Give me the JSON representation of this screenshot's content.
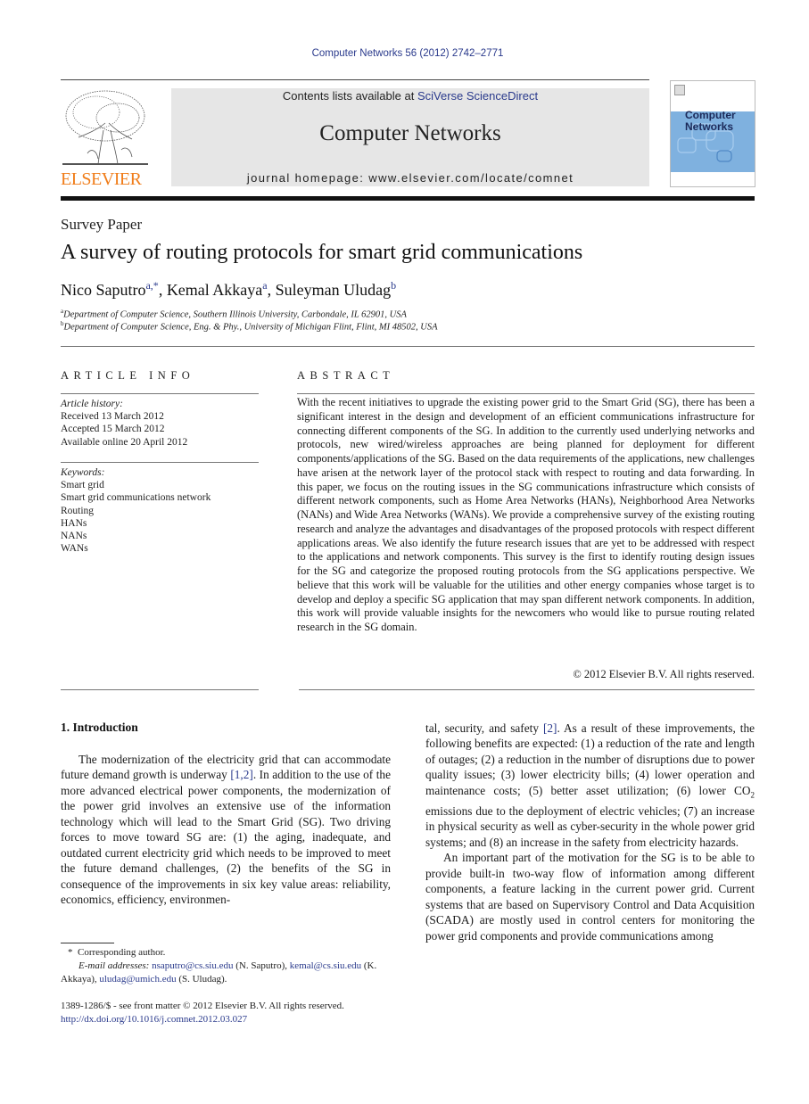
{
  "header": {
    "journal_reference": "Computer Networks 56 (2012) 2742–2771",
    "contents_prefix": "Contents lists available at ",
    "contents_link": "SciVerse ScienceDirect",
    "journal_name": "Computer Networks",
    "homepage": "journal homepage: www.elsevier.com/locate/comnet",
    "publisher_logo_text": "ELSEVIER",
    "cover_title_line1": "Computer",
    "cover_title_line2": "Networks",
    "colors": {
      "publisher_orange": "#f07d1a",
      "link_blue": "#2a3a8c",
      "cover_blue": "#7fb1df",
      "banner_gray": "#e6e6e6"
    }
  },
  "article": {
    "type_label": "Survey Paper",
    "title": "A survey of routing protocols for smart grid communications",
    "authors": [
      {
        "name": "Nico Saputro",
        "marks": "a,*"
      },
      {
        "name": "Kemal Akkaya",
        "marks": "a"
      },
      {
        "name": "Suleyman Uludag",
        "marks": "b"
      }
    ],
    "affiliations": [
      {
        "mark": "a",
        "text": "Department of Computer Science, Southern Illinois University, Carbondale, IL 62901, USA"
      },
      {
        "mark": "b",
        "text": "Department of Computer Science, Eng. & Phy., University of Michigan Flint, Flint, MI 48502, USA"
      }
    ]
  },
  "article_info": {
    "heading": "ARTICLE INFO",
    "history_label": "Article history:",
    "history": [
      "Received 13 March 2012",
      "Accepted 15 March 2012",
      "Available online 20 April 2012"
    ],
    "keywords_label": "Keywords:",
    "keywords": [
      "Smart grid",
      "Smart grid communications network",
      "Routing",
      "HANs",
      "NANs",
      "WANs"
    ]
  },
  "abstract": {
    "heading": "ABSTRACT",
    "text": "With the recent initiatives to upgrade the existing power grid to the Smart Grid (SG), there has been a significant interest in the design and development of an efficient communications infrastructure for connecting different components of the SG. In addition to the currently used underlying networks and protocols, new wired/wireless approaches are being planned for deployment for different components/applications of the SG. Based on the data requirements of the applications, new challenges have arisen at the network layer of the protocol stack with respect to routing and data forwarding. In this paper, we focus on the routing issues in the SG communications infrastructure which consists of different network components, such as Home Area Networks (HANs), Neighborhood Area Networks (NANs) and Wide Area Networks (WANs). We provide a comprehensive survey of the existing routing research and analyze the advantages and disadvantages of the proposed protocols with respect different applications areas. We also identify the future research issues that are yet to be addressed with respect to the applications and network components. This survey is the first to identify routing design issues for the SG and categorize the proposed routing protocols from the SG applications perspective. We believe that this work will be valuable for the utilities and other energy companies whose target is to develop and deploy a specific SG application that may span different network components. In addition, this work will provide valuable insights for the newcomers who would like to pursue routing related research in the SG domain.",
    "copyright": "© 2012 Elsevier B.V. All rights reserved."
  },
  "body": {
    "section_heading": "1. Introduction",
    "left_p1_a": "The modernization of the electricity grid that can accommodate future demand growth is underway ",
    "left_p1_cite": "[1,2]",
    "left_p1_b": ". In addition to the use of the more advanced electrical power components, the modernization of the power grid involves an extensive use of the information technology which will lead to the Smart Grid (SG). Two driving forces to move toward SG are: (1) the aging, inadequate, and outdated current electricity grid which needs to be improved to meet the future demand challenges, (2) the benefits of the SG in consequence of the improvements in six key value areas: reliability, economics, efficiency, environmen-",
    "right_p1_a": "tal, security, and safety ",
    "right_p1_cite": "[2]",
    "right_p1_b": ". As a result of these improvements, the following benefits are expected: (1) a reduction of the rate and length of outages; (2) a reduction in the number of disruptions due to power quality issues; (3) lower electricity bills; (4) lower operation and maintenance costs; (5) better asset utilization; (6) lower CO",
    "right_p1_sub": "2",
    "right_p1_c": " emissions due to the deployment of electric vehicles; (7) an increase in physical security as well as cyber-security in the whole power grid systems; and (8) an increase in the safety from electricity hazards.",
    "right_p2": "An important part of the motivation for the SG is to be able to provide built-in two-way flow of information among different components, a feature lacking in the current power grid. Current systems that are based on Supervisory Control and Data Acquisition (SCADA) are mostly used in control centers for monitoring the power grid components and provide communications among"
  },
  "footnotes": {
    "corresponding_mark": "*",
    "corresponding_text": "Corresponding author.",
    "email_label": "E-mail addresses:",
    "emails": [
      {
        "address": "nsaputro@cs.siu.edu",
        "owner": "(N. Saputro)"
      },
      {
        "address": "kemal@cs.siu.edu",
        "owner": "(K. Akkaya)"
      },
      {
        "address": "uludag@umich.edu",
        "owner": "(S. Uludag)."
      }
    ],
    "issn_line": "1389-1286/$ - see front matter © 2012 Elsevier B.V. All rights reserved.",
    "doi": "http://dx.doi.org/10.1016/j.comnet.2012.03.027"
  }
}
